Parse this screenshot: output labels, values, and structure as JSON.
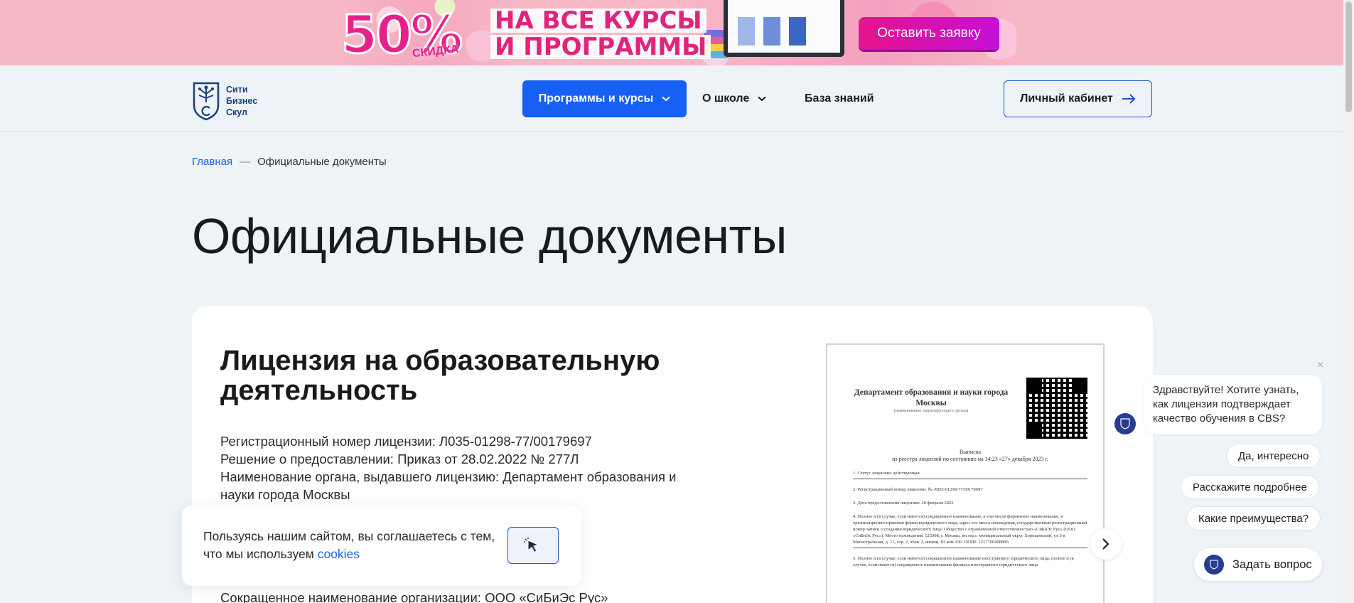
{
  "promo": {
    "percent": "50%",
    "percent_sub": "СКИДКА",
    "line1": "НА ВСЕ КУРСЫ",
    "line2": "И ПРОГРАММЫ",
    "cta": "Оставить заявку"
  },
  "header": {
    "logo_lines": [
      "Сити",
      "Бизнес",
      "Скул"
    ],
    "nav": {
      "programs": "Программы и курсы",
      "school": "О школе",
      "knowledge": "База знаний"
    },
    "cabinet": "Личный кабинет"
  },
  "breadcrumb": {
    "home": "Главная",
    "separator": "—",
    "current": "Официальные документы"
  },
  "page_title": "Официальные документы",
  "license": {
    "title": "Лицензия на образовательную деятельность",
    "lines": [
      "Регистрационный номер лицензии: Л035-01298-77/00179697",
      "Решение о предоставлении: Приказ от 28.02.2022 № 277Л",
      "Наименование органа, выдавшего лицензию: Департамент образования и науки города Москвы"
    ],
    "lower_line": "Сокращенное наименование организации: ООО «СиБиЭс Рус»",
    "document": {
      "heading": "Департамент образования и науки города Москвы",
      "heading_note": "(наименование лицензирующего органа)",
      "subtitle_1": "Выписка",
      "subtitle_2": "из реестра лицензий по состоянию на 14:23 «27» декабря 2023 г.",
      "items": [
        "1. Статус лицензии: действующая",
        "2. Регистрационный номер лицензии: № Л035-01298-77/00179697",
        "3. Дата предоставления лицензии: 28 февраля 2022",
        "4. Полное и (в случае, если имеется) сокращенное наименование, в том числе фирменное наименование, и организационно-правовая форма юридического лица, адрес его места нахождения, государственный регистрационный номер записи о создании юридического лица: Общество с ограниченной ответственностью «СиБиЭс Рус» (ООО «СиБиЭс Рус»). Место нахождения: 123308, г. Москва, вн.тер.г. муниципальный округ Хорошевский, ул 3-я Магистральная, д. 11, стр. 2, этаж 2, помещ. III ком 106. ОГРН: 1217700408800.",
        "5. Полное и (в случае, если имеется) сокращенное наименование иностранного юридического лица, полное и (в случае, если имеется) сокращенное наименование филиала иностранного юридического лица"
      ]
    }
  },
  "cookie": {
    "text_before": "Пользуясь нашим сайтом, вы соглашаетесь с тем, что мы используем ",
    "link": "cookies"
  },
  "chat": {
    "close": "×",
    "greeting": "Здравствуйте! Хотите узнать, как лицензия подтверждает качество обучения в CBS?",
    "chips": [
      "Да, интересно",
      "Расскажите подробнее",
      "Какие преимущества?"
    ],
    "ask": "Задать вопрос"
  },
  "colors": {
    "accent": "#1760f5",
    "promo_bg": "#f7b8c6",
    "page_bg": "#eef3f7",
    "brand_dark": "#273d8e"
  }
}
